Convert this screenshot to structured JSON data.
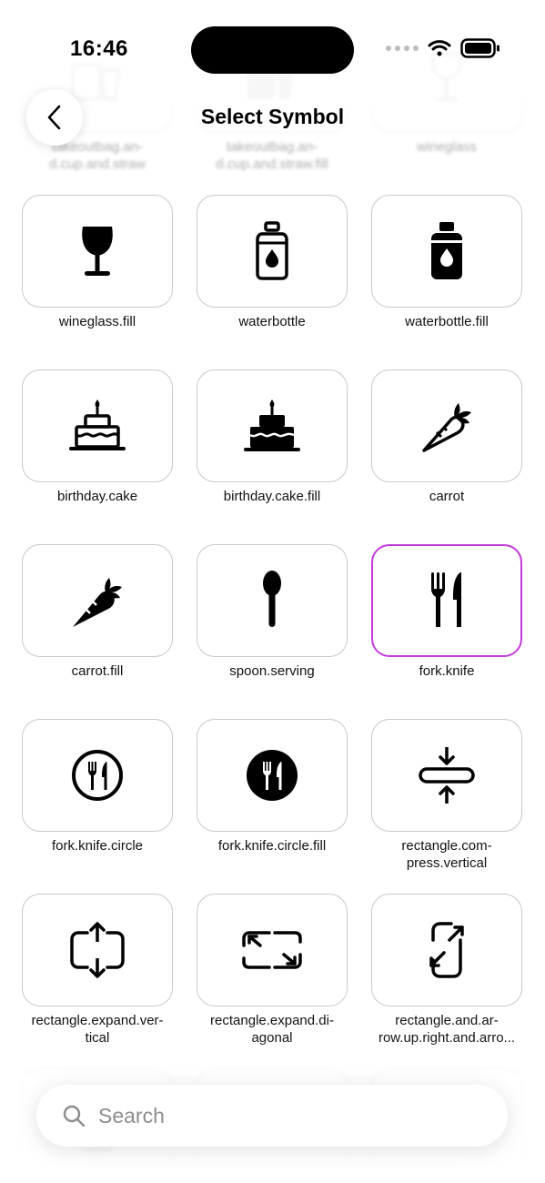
{
  "status": {
    "time": "16:46"
  },
  "header": {
    "title": "Select Symbol"
  },
  "search": {
    "placeholder": "Search"
  },
  "symbols": [
    {
      "label": "takeoutbag.and.cup.and.straw"
    },
    {
      "label": "takeoutbag.and.cup.and.straw.fill"
    },
    {
      "label": "wineglass"
    },
    {
      "label": "wineglass.fill"
    },
    {
      "label": "waterbottle"
    },
    {
      "label": "waterbottle.fill"
    },
    {
      "label": "birthday.cake"
    },
    {
      "label": "birthday.cake.fill"
    },
    {
      "label": "carrot"
    },
    {
      "label": "carrot.fill"
    },
    {
      "label": "spoon.serving"
    },
    {
      "label": "fork.knife",
      "selected": true
    },
    {
      "label": "fork.knife.circle"
    },
    {
      "label": "fork.knife.circle.fill"
    },
    {
      "label": "rectangle.compress.vertical"
    },
    {
      "label": "rectangle.expand.vertical"
    },
    {
      "label": "rectangle.expand.diagonal"
    },
    {
      "label": "rectangle.and.arrow.up.right.and.arrow.down.left"
    },
    {
      "label": ""
    },
    {
      "label": ""
    },
    {
      "label": ""
    }
  ],
  "displayed_labels": [
    "takeoutbag.an-\nd.cup.and.straw",
    "takeoutbag.an-\nd.cup.and.straw.fill",
    "wineglass",
    "wineglass.fill",
    "waterbottle",
    "waterbottle.fill",
    "birthday.cake",
    "birthday.cake.fill",
    "carrot",
    "carrot.fill",
    "spoon.serving",
    "fork.knife",
    "fork.knife.circle",
    "fork.knife.circle.fill",
    "rectangle.com-\npress.vertical",
    "rectangle.expand.ver-\ntical",
    "rectangle.expand.di-\nagonal",
    "rectangle.and.ar-\nrow.up.right.and.arro...",
    "",
    "",
    ""
  ],
  "colors": {
    "selected_border": "#c23cd9",
    "tile_border": "#c9c9c9"
  }
}
